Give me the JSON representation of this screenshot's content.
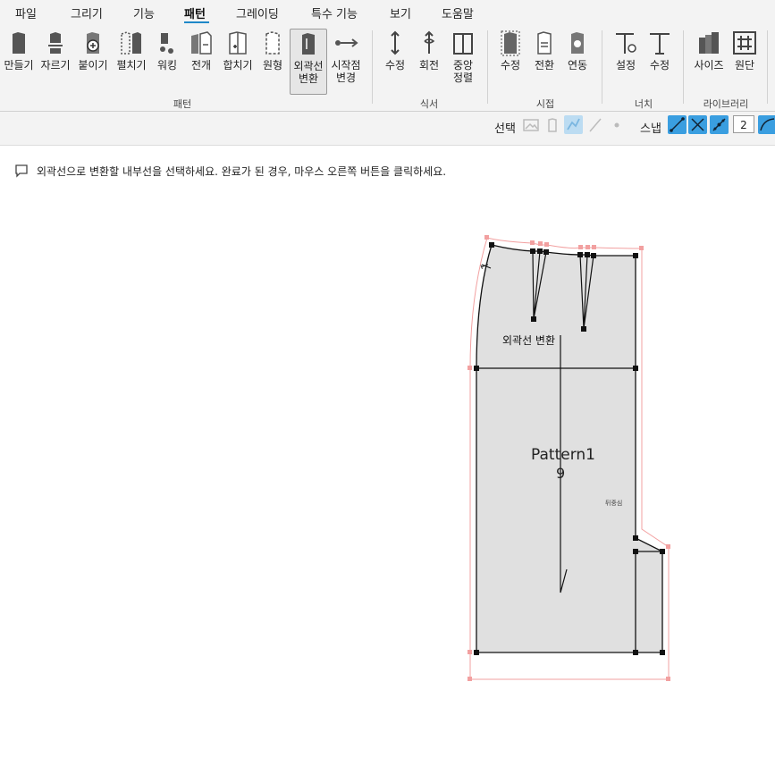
{
  "menu": [
    "파일",
    "그리기",
    "기능",
    "패턴",
    "그레이딩",
    "특수 기능",
    "보기",
    "도움말"
  ],
  "ribbon": {
    "pattern_tools": [
      "만들기",
      "자르기",
      "붙이기",
      "펼치기",
      "워킹",
      "전개",
      "합치기",
      "원형",
      "외곽선\n변환",
      "시작점\n변경"
    ],
    "pattern_group": "패턴",
    "sikseo_tools": [
      "수정",
      "회전",
      "중앙\n정렬"
    ],
    "sikseo_group": "식서",
    "sijeop_tools": [
      "수정",
      "전환",
      "연동"
    ],
    "sijeop_group": "시접",
    "notch_tools": [
      "설정",
      "수정"
    ],
    "notch_group": "너치",
    "library_tools": [
      "사이즈",
      "원단"
    ],
    "library_group": "라이브러리"
  },
  "snapbar": {
    "select_label": "선택",
    "snap_label": "스냅",
    "snap_value": "2"
  },
  "hint": "외곽선으로 변환할 내부선을 선택하세요. 완료가 된 경우, 마우스 오른쪽 버튼을 클릭하세요.",
  "canvas": {
    "selection_label": "외곽선 변환",
    "pattern_name": "Pattern1",
    "pattern_number": "9",
    "back_center": "뒤중심",
    "seam_mark": "1"
  },
  "colors": {
    "accent": "#3a9ee0",
    "pattern_fill": "#e0e0e0",
    "seam_allowance": "#f2a0a0"
  }
}
